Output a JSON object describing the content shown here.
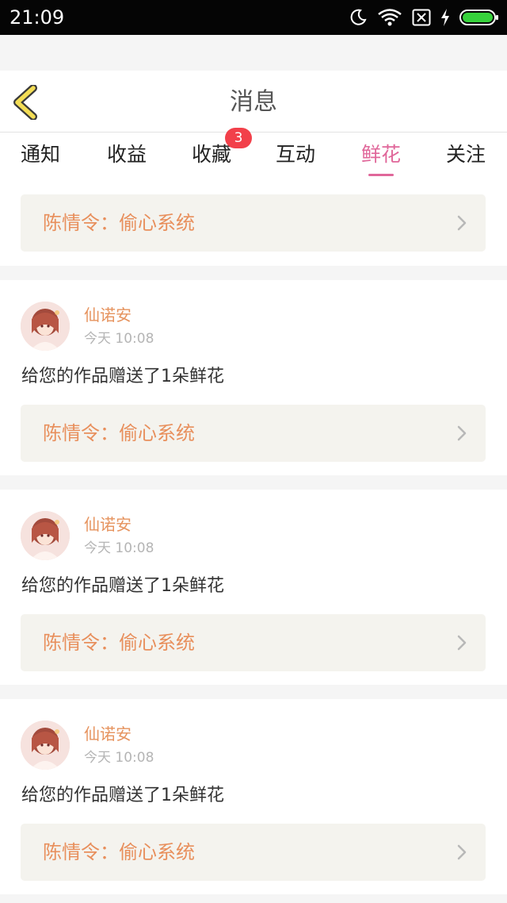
{
  "status_bar": {
    "time": "21:09",
    "icons": [
      "moon-icon",
      "wifi-icon",
      "no-sim-icon",
      "charging-icon",
      "battery-icon"
    ]
  },
  "header": {
    "title": "消息",
    "back_icon": "chevron-left-icon"
  },
  "tabs": [
    {
      "label": "通知",
      "active": false
    },
    {
      "label": "收益",
      "active": false
    },
    {
      "label": "收藏",
      "active": false,
      "badge": "3"
    },
    {
      "label": "互动",
      "active": false
    },
    {
      "label": "鲜花",
      "active": true
    },
    {
      "label": "关注",
      "active": false
    }
  ],
  "first_card": {
    "work_title": "陈情令：偷心系统"
  },
  "messages": [
    {
      "sender": "仙诺安",
      "time": "今天 10:08",
      "text": "给您的作品赠送了1朵鲜花",
      "work_title": "陈情令：偷心系统"
    },
    {
      "sender": "仙诺安",
      "time": "今天 10:08",
      "text": "给您的作品赠送了1朵鲜花",
      "work_title": "陈情令：偷心系统"
    },
    {
      "sender": "仙诺安",
      "time": "今天 10:08",
      "text": "给您的作品赠送了1朵鲜花",
      "work_title": "陈情令：偷心系统"
    }
  ],
  "colors": {
    "accent_pink": "#e0679a",
    "name_orange": "#e6935e",
    "work_orange": "#e88f5c",
    "back_arrow": "#f3dd55",
    "badge_red": "#f2404a",
    "link_bg": "#f4f3ee"
  }
}
